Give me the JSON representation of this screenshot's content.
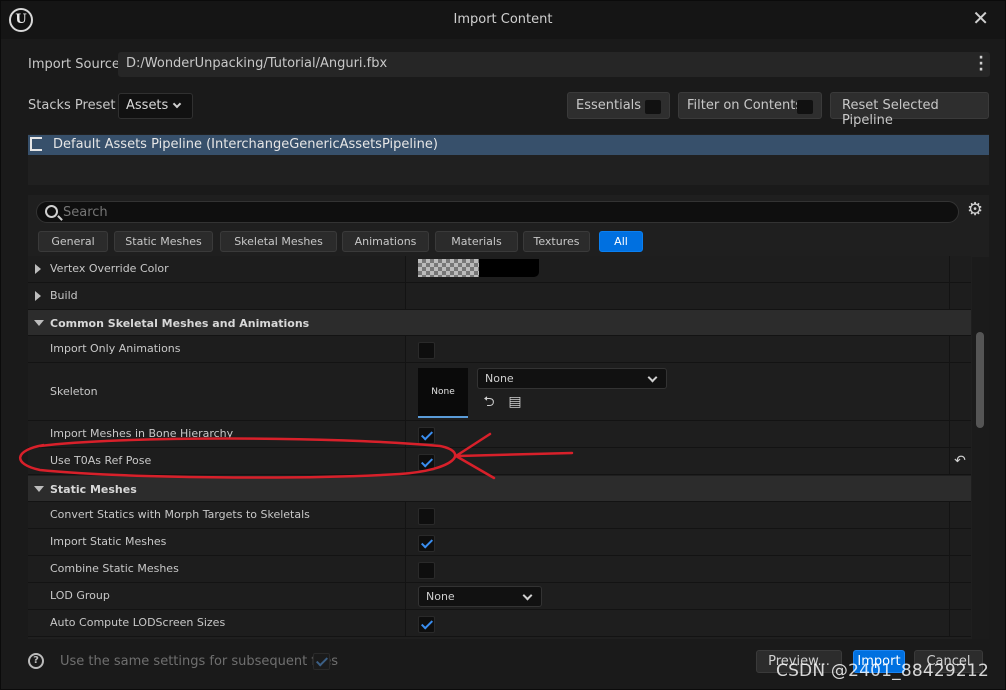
{
  "window": {
    "title": "Import Content",
    "logo_icon": "unreal-logo-icon",
    "close_label": "✕"
  },
  "import_source": {
    "label": "Import Source",
    "value": "D:/WonderUnpacking/Tutorial/Anguri.fbx"
  },
  "stacks": {
    "label": "Stacks Preset",
    "selected": "Assets",
    "essentials_label": "Essentials",
    "filter_label": "Filter on Contents",
    "reset_label": "Reset Selected Pipeline"
  },
  "pipeline": {
    "selected_item": "Default Assets Pipeline (InterchangeGenericAssetsPipeline)"
  },
  "search": {
    "placeholder": "Search"
  },
  "tabs": [
    {
      "label": "General"
    },
    {
      "label": "Static Meshes"
    },
    {
      "label": "Skeletal Meshes"
    },
    {
      "label": "Animations"
    },
    {
      "label": "Materials"
    },
    {
      "label": "Textures"
    },
    {
      "label": "All"
    }
  ],
  "properties": {
    "vertex_override_color": "Vertex Override Color",
    "build": "Build",
    "cat_common": "Common Skeletal Meshes and Animations",
    "import_only_animations": {
      "label": "Import Only Animations",
      "checked": false
    },
    "skeleton": {
      "label": "Skeleton",
      "thumb": "None",
      "value": "None"
    },
    "import_meshes_bone_hierarchy": {
      "label": "Import Meshes in Bone Hierarchy",
      "checked": true
    },
    "use_t0as_ref_pose": {
      "label": "Use T0As Ref Pose",
      "checked": true
    },
    "cat_static": "Static Meshes",
    "convert_statics": {
      "label": "Convert Statics with Morph Targets to Skeletals",
      "checked": false
    },
    "import_static_meshes": {
      "label": "Import Static Meshes",
      "checked": true
    },
    "combine_static_meshes": {
      "label": "Combine Static Meshes",
      "checked": false
    },
    "lod_group": {
      "label": "LOD Group",
      "value": "None"
    },
    "auto_compute_lod": {
      "label": "Auto Compute LODScreen Sizes",
      "checked": true
    }
  },
  "footer": {
    "help_label": "?",
    "use_same_settings": "Use the same settings for subsequent files",
    "preview_label": "Preview...",
    "import_label": "Import",
    "cancel_label": "Cancel"
  },
  "watermark": "CSDN @2401_88429212",
  "colors": {
    "accent": "#0070e0",
    "pipeline_selected": "#37506b",
    "annotation_red": "#d8202a"
  }
}
